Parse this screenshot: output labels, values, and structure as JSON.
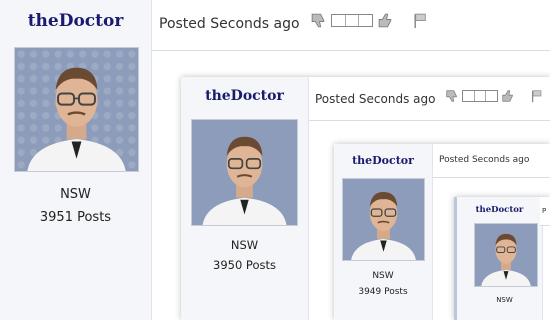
{
  "level1": {
    "username": "theDoctor",
    "posted": "Posted Seconds ago",
    "location": "NSW",
    "posts": "3951 Posts"
  },
  "level2": {
    "username": "theDoctor",
    "posted": "Posted Seconds ago",
    "location": "NSW",
    "posts": "3950 Posts"
  },
  "level3": {
    "username": "theDoctor",
    "posted": "Posted Seconds ago",
    "location": "NSW",
    "posts": "3949 Posts"
  },
  "level4": {
    "username": "theDoctor",
    "posted": "P",
    "location": "NSW",
    "posts": ""
  },
  "icons": {
    "thumb_down": "thumbs-down-icon",
    "thumb_up": "thumbs-up-icon",
    "flag": "flag-icon"
  },
  "colors": {
    "username": "#1a1a6e",
    "sidebar_bg": "#f5f6f9",
    "border": "#d9dce4"
  }
}
